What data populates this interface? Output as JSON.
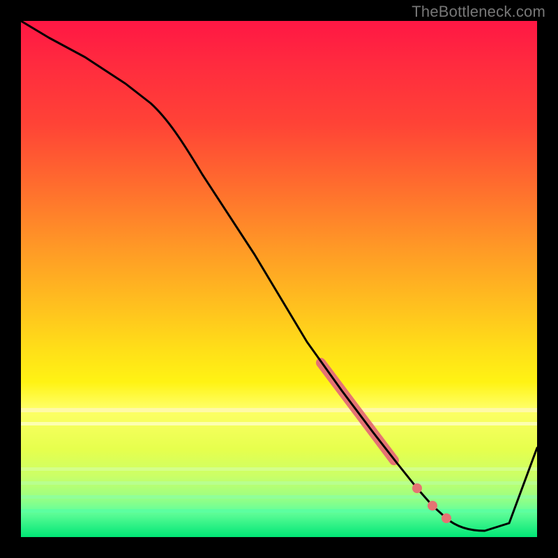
{
  "watermark": "TheBottleneck.com",
  "chart_data": {
    "type": "line",
    "title": "",
    "xlabel": "",
    "ylabel": "",
    "xlim": [
      0,
      100
    ],
    "ylim": [
      0,
      100
    ],
    "grid": false,
    "legend": false,
    "series": [
      {
        "name": "bottleneck-curve",
        "x": [
          0,
          5,
          12,
          20,
          25,
          30,
          45,
          55,
          62,
          68,
          72,
          75,
          78,
          82,
          86,
          90,
          100
        ],
        "y": [
          100,
          97,
          93,
          88,
          84,
          80,
          55,
          38,
          27,
          19,
          14,
          10,
          6,
          3,
          1,
          1,
          18
        ]
      }
    ],
    "highlight_segment": {
      "x_start": 58,
      "x_end": 72
    },
    "highlight_points": [
      {
        "x": 77,
        "y": 7
      },
      {
        "x": 80,
        "y": 4
      },
      {
        "x": 82,
        "y": 2
      }
    ],
    "background_gradient": {
      "top_color": "#ff1744",
      "mid_color": "#ffee00",
      "bottom_color": "#00e676"
    }
  }
}
